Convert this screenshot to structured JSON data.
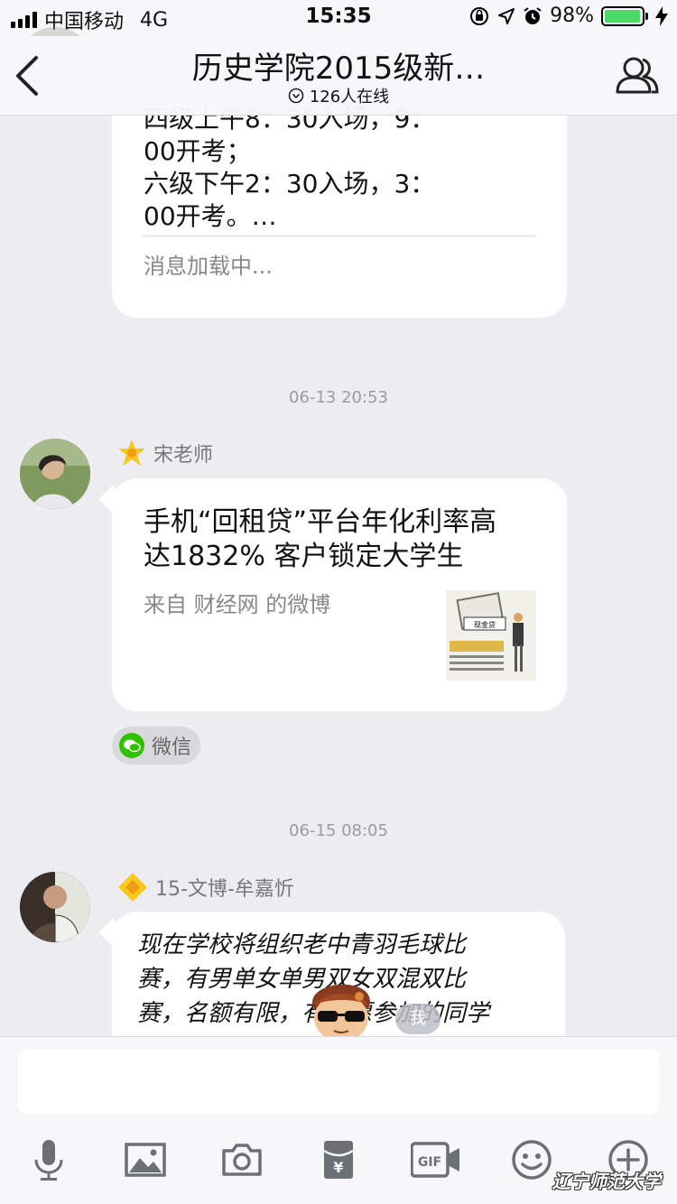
{
  "status_bar": {
    "carrier": "中国移动",
    "network": "4G",
    "time": "15:35",
    "battery": "98%",
    "battery_level": 0.98,
    "icons": [
      "rotation-lock-icon",
      "location-icon",
      "alarm-icon",
      "charging-icon"
    ]
  },
  "header": {
    "title": "历史学院2015级新…",
    "online": "126人在线"
  },
  "messages": {
    "first": {
      "lines": [
        "四级上午8：30入场，9：",
        "00开考；",
        "六级下午2：30入场，3：",
        "00开考。…"
      ],
      "loading": "消息加载中..."
    },
    "time1": "06-13 20:53",
    "second": {
      "sender": "宋老师",
      "title_line1": "手机“回租贷”平台年化利率高",
      "title_line2": "达1832% 客户锁定大学生",
      "source": "来自 财经网 的微博",
      "thumb_label": "现金贷",
      "chip": "微信"
    },
    "time2": "06-15 08:05",
    "third": {
      "sender": "15-文博-牟嘉忻",
      "lines": [
        "现在学校将组织老中青羽毛球比",
        "赛，有男单女单男双女双混双比",
        "赛，名额有限，有意愿参加的同学"
      ],
      "sticker_label": "我"
    }
  },
  "toolbar": {
    "icons": [
      "microphone-icon",
      "image-icon",
      "camera-icon",
      "red-packet-icon",
      "gif-icon",
      "emoji-icon",
      "plus-icon"
    ]
  },
  "watermark": "辽宁师范大学",
  "colors": {
    "accent_green": "#4cd964",
    "wechat_green": "#2dc100",
    "star": "#f7c81e",
    "background": "#ececf1"
  }
}
